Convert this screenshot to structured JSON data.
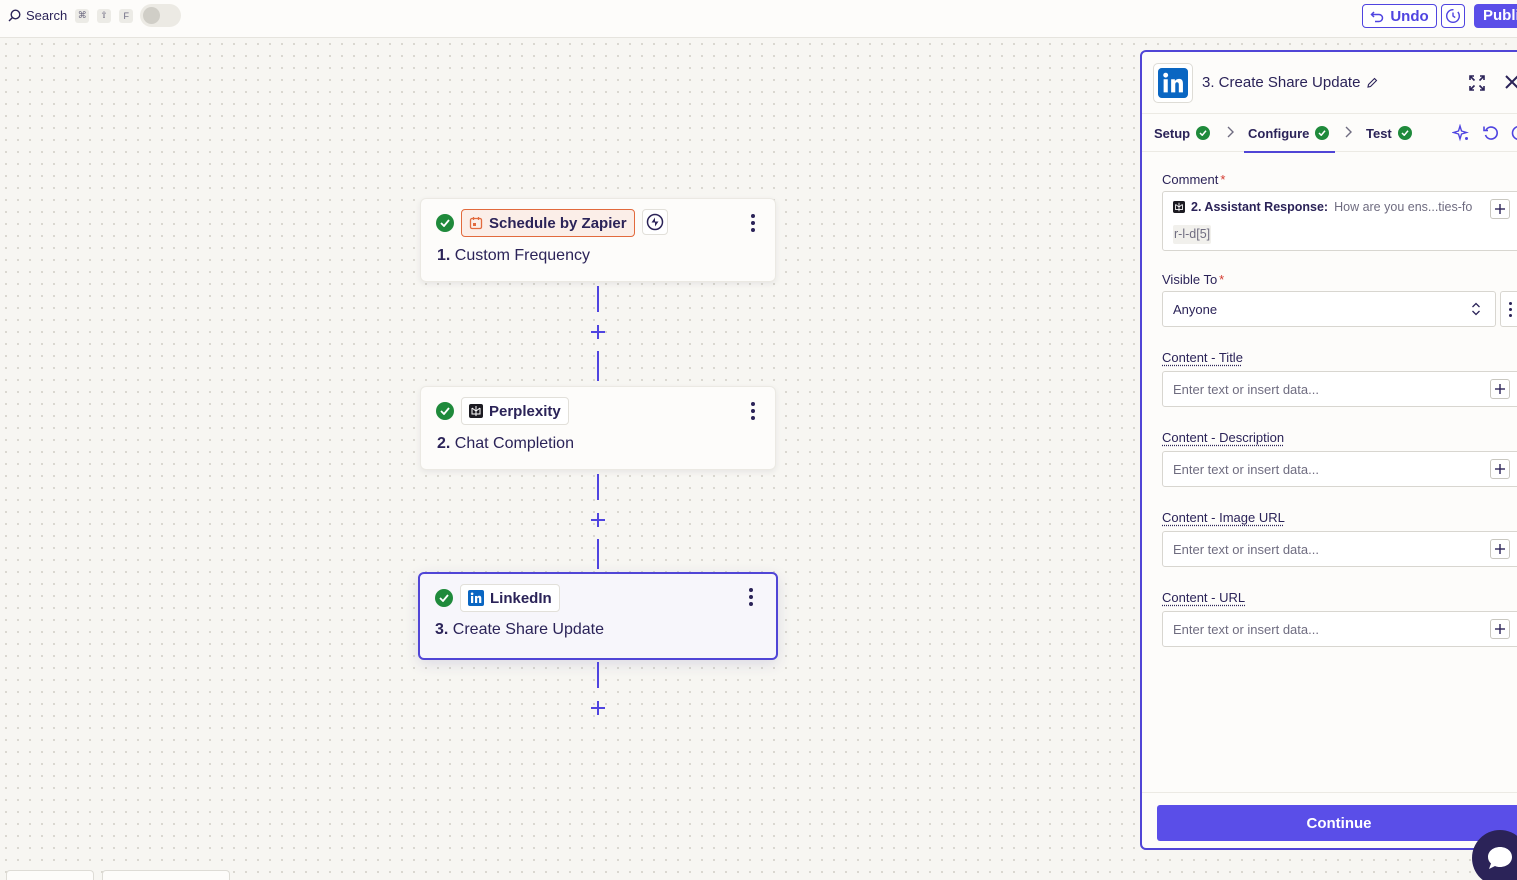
{
  "topbar": {
    "search_label": "Search",
    "shortcut_keys": [
      "⌘",
      "⇧",
      "F"
    ],
    "undo_label": "Undo",
    "publish_label": "Publish"
  },
  "canvas": {
    "steps": [
      {
        "app_name": "Schedule by Zapier",
        "number": "1.",
        "title": "Custom Frequency",
        "icon": "calendar-icon"
      },
      {
        "app_name": "Perplexity",
        "number": "2.",
        "title": "Chat Completion",
        "icon": "perplexity-logo-icon"
      },
      {
        "app_name": "LinkedIn",
        "number": "3.",
        "title": "Create Share Update",
        "icon": "linkedin-logo-icon"
      }
    ]
  },
  "panel": {
    "title": "3. Create Share Update",
    "tabs": [
      {
        "label": "Setup"
      },
      {
        "label": "Configure"
      },
      {
        "label": "Test"
      }
    ],
    "fields": {
      "comment": {
        "label": "Comment",
        "required": "*",
        "chip_label": "2. Assistant Response:",
        "chip_value": "How are you ens...ties-fo",
        "tail": "r-l-d[5]"
      },
      "visible_to": {
        "label": "Visible To",
        "required": "*",
        "value": "Anyone"
      },
      "content_title": {
        "label": "Content - Title",
        "placeholder": "Enter text or insert data..."
      },
      "content_description": {
        "label": "Content - Description",
        "placeholder": "Enter text or insert data..."
      },
      "content_image_url": {
        "label": "Content - Image URL",
        "placeholder": "Enter text or insert data..."
      },
      "content_url": {
        "label": "Content - URL",
        "placeholder": "Enter text or insert data..."
      }
    },
    "continue_label": "Continue"
  },
  "colors": {
    "accent": "#5045d6",
    "primary_button": "#5a4ee8",
    "success": "#1f8a3b",
    "schedule_orange": "#e26a3d",
    "linkedin_blue": "#0a66c2"
  }
}
